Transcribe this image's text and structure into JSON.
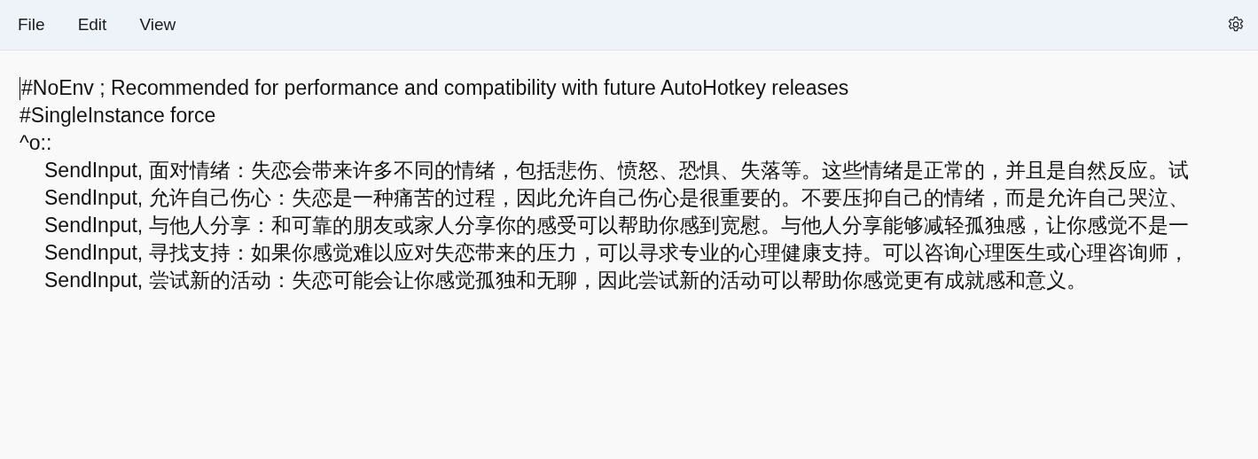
{
  "menu": [
    {
      "label": "File"
    },
    {
      "label": "Edit"
    },
    {
      "label": "View"
    }
  ],
  "editor": {
    "lines": [
      {
        "text": "#NoEnv ; Recommended for performance and compatibility with future AutoHotkey releases"
      },
      {
        "text": "#SingleInstance force"
      },
      {
        "text": "^o::",
        "children": [
          {
            "text": "SendInput, 面对情绪：失恋会带来许多不同的情绪，包括悲伤、愤怒、恐惧、失落等。这些情绪是正常的，并且是自然反应。试"
          },
          {
            "text": "SendInput, 允许自己伤心：失恋是一种痛苦的过程，因此允许自己伤心是很重要的。不要压抑自己的情绪，而是允许自己哭泣、"
          },
          {
            "text": "SendInput, 与他人分享：和可靠的朋友或家人分享你的感受可以帮助你感到宽慰。与他人分享能够减轻孤独感，让你感觉不是一"
          },
          {
            "text": "SendInput, 寻找支持：如果你感觉难以应对失恋带来的压力，可以寻求专业的心理健康支持。可以咨询心理医生或心理咨询师，"
          },
          {
            "text": "SendInput, 尝试新的活动：失恋可能会让你感觉孤独和无聊，因此尝试新的活动可以帮助你感觉更有成就感和意义。"
          }
        ]
      }
    ]
  }
}
